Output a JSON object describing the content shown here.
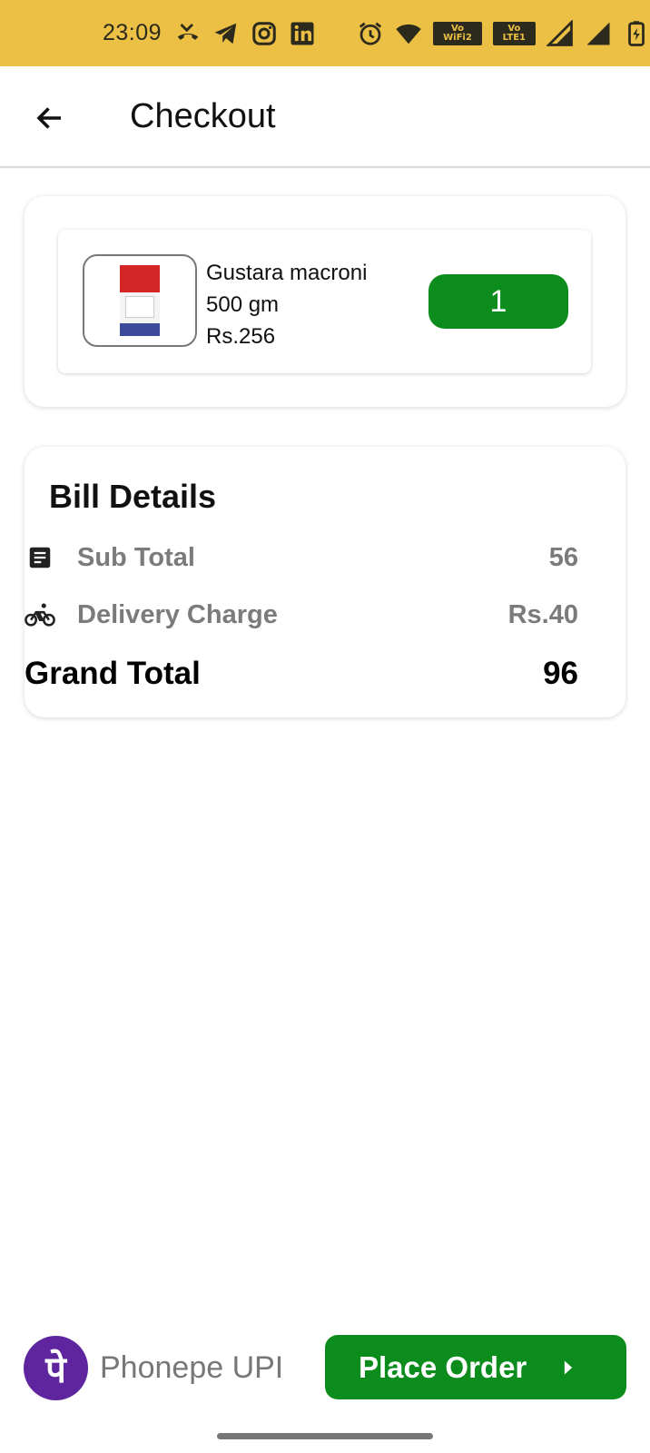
{
  "status_bar": {
    "time": "23:09",
    "wifi_tag": "Vo WiFi2",
    "lte_tag": "Vo LTE1",
    "icons": [
      "missed-call-icon",
      "telegram-icon",
      "instagram-icon",
      "linkedin-icon",
      "alarm-icon",
      "wifi-icon",
      "signal-icon",
      "signal-icon",
      "battery-icon"
    ]
  },
  "app_bar": {
    "title": "Checkout"
  },
  "cart": {
    "items": [
      {
        "name": "Gustara macroni",
        "size": "500 gm",
        "price": "Rs.256",
        "quantity": "1"
      }
    ]
  },
  "bill": {
    "title": "Bill Details",
    "subtotal_label": "Sub Total",
    "subtotal_value": "56",
    "delivery_label": "Delivery Charge",
    "delivery_value": "Rs.40",
    "grand_label": "Grand Total",
    "grand_value": "96"
  },
  "payment": {
    "method": "Phonepe UPI",
    "logo_glyph": "पे"
  },
  "actions": {
    "place_order": "Place Order"
  },
  "colors": {
    "status_bar": "#ECC044",
    "accent_green": "#0B8C1C",
    "phonepe_purple": "#5F259F"
  }
}
